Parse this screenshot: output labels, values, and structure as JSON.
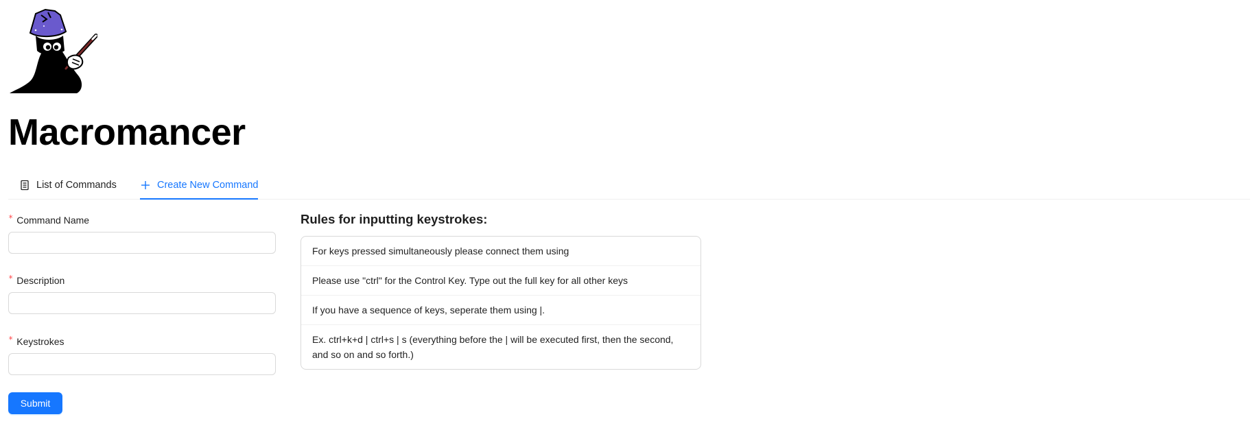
{
  "app": {
    "title": "Macromancer"
  },
  "tabs": [
    {
      "label": "List of Commands",
      "icon": "book-icon",
      "active": false
    },
    {
      "label": "Create New Command",
      "icon": "plus-icon",
      "active": true
    }
  ],
  "form": {
    "fields": [
      {
        "label": "Command Name",
        "required": true,
        "value": "",
        "placeholder": ""
      },
      {
        "label": "Description",
        "required": true,
        "value": "",
        "placeholder": ""
      },
      {
        "label": "Keystrokes",
        "required": true,
        "value": "",
        "placeholder": ""
      }
    ],
    "required_mark": "*",
    "submit_label": "Submit"
  },
  "rules": {
    "title": "Rules for inputting keystrokes:",
    "items": [
      "For keys pressed simultaneously please connect them using",
      "Please use \"ctrl\" for the Control Key. Type out the full key for all other keys",
      "If you have a sequence of keys, seperate them using |.",
      "Ex. ctrl+k+d | ctrl+s | s (everything before the | will be executed first, then the second, and so on and so forth.)"
    ]
  },
  "colors": {
    "accent": "#1677ff",
    "required": "#ff4d4f",
    "logo_hat": "#6a5acd"
  }
}
